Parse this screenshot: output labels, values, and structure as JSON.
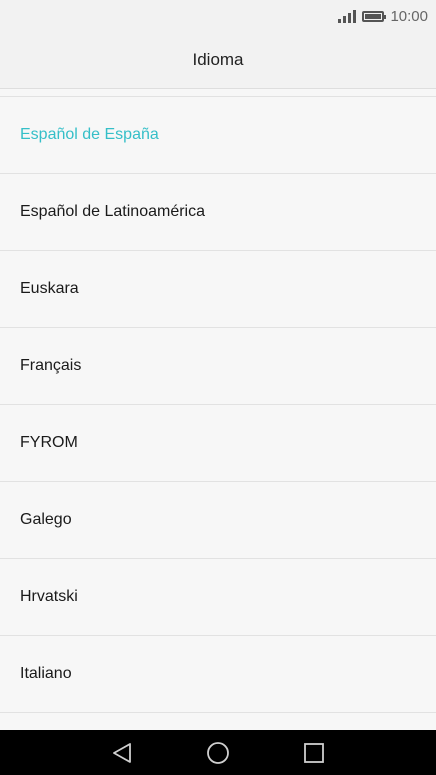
{
  "status_bar": {
    "time": "10:00"
  },
  "header": {
    "title": "Idioma"
  },
  "languages": [
    {
      "label": "Español de España",
      "selected": true
    },
    {
      "label": "Español de Latinoamérica",
      "selected": false
    },
    {
      "label": "Euskara",
      "selected": false
    },
    {
      "label": "Français",
      "selected": false
    },
    {
      "label": "FYROM",
      "selected": false
    },
    {
      "label": "Galego",
      "selected": false
    },
    {
      "label": "Hrvatski",
      "selected": false
    },
    {
      "label": "Italiano",
      "selected": false
    }
  ],
  "colors": {
    "accent": "#35bfc8",
    "nav_background": "#000000"
  },
  "nav_bar": {
    "icons": [
      "back-icon",
      "home-icon",
      "recents-icon"
    ]
  }
}
